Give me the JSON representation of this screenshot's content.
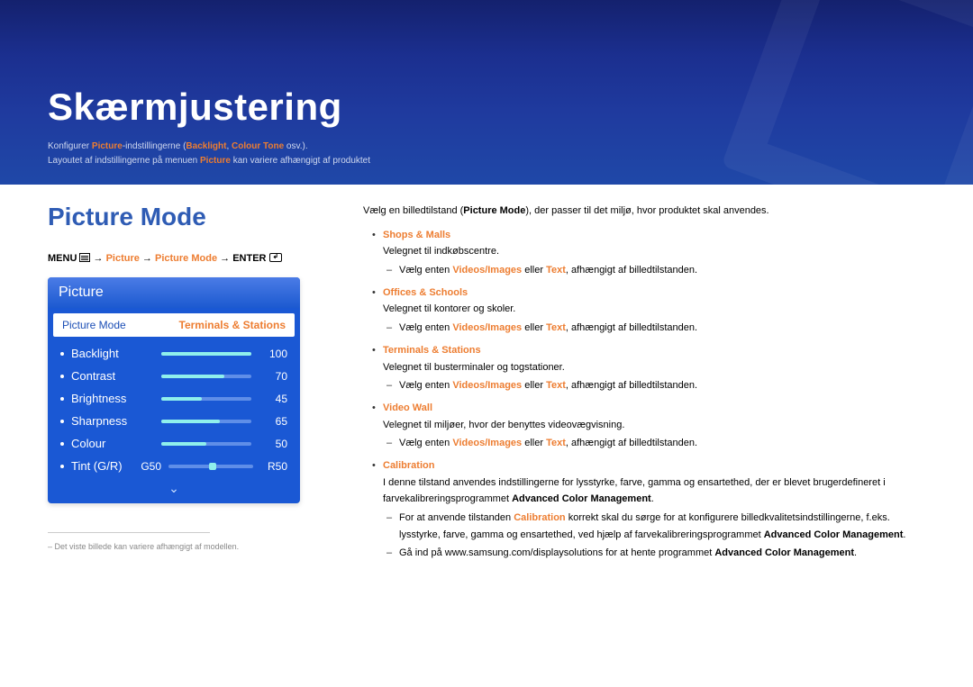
{
  "banner": {
    "title": "Skærmjustering",
    "desc1_a": "Konfigurer ",
    "desc1_b": "Picture",
    "desc1_c": "-indstillingerne (",
    "desc1_d": "Backlight",
    "desc1_e": ", ",
    "desc1_f": "Colour Tone",
    "desc1_g": " osv.).",
    "desc2_a": "Layoutet af indstillingerne på menuen ",
    "desc2_b": "Picture",
    "desc2_c": " kan variere afhængigt af produktet"
  },
  "section_title": "Picture Mode",
  "path": {
    "menu": "MENU ",
    "arrow": " → ",
    "step1": "Picture",
    "step2": "Picture Mode",
    "enter": "ENTER"
  },
  "osd": {
    "header": "Picture",
    "row_label": "Picture Mode",
    "row_value": "Terminals & Stations",
    "items": [
      {
        "label": "Backlight",
        "value": "100",
        "pct": 100
      },
      {
        "label": "Contrast",
        "value": "70",
        "pct": 70
      },
      {
        "label": "Brightness",
        "value": "45",
        "pct": 45
      },
      {
        "label": "Sharpness",
        "value": "65",
        "pct": 65
      },
      {
        "label": "Colour",
        "value": "50",
        "pct": 50
      }
    ],
    "tint_label": "Tint (G/R)",
    "tint_g": "G50",
    "tint_r": "R50"
  },
  "note": "Det viste billede kan variere afhængigt af modellen.",
  "right": {
    "intro_a": "Vælg en billedtilstand (",
    "intro_b": "Picture Mode",
    "intro_c": "), der passer til det miljø, hvor produktet skal anvendes.",
    "modes": [
      {
        "name": "Shops & Malls",
        "desc": "Velegnet til indkøbscentre.",
        "sub_a": "Vælg enten ",
        "sub_b": "Videos/Images",
        "sub_c": " eller ",
        "sub_d": "Text",
        "sub_e": ", afhængigt af billedtilstanden."
      },
      {
        "name": "Offices & Schools",
        "desc": "Velegnet til kontorer og skoler.",
        "sub_a": "Vælg enten ",
        "sub_b": "Videos/Images",
        "sub_c": " eller ",
        "sub_d": "Text",
        "sub_e": ", afhængigt af billedtilstanden."
      },
      {
        "name": "Terminals & Stations",
        "desc": "Velegnet til busterminaler og togstationer.",
        "sub_a": "Vælg enten ",
        "sub_b": "Videos/Images",
        "sub_c": " eller ",
        "sub_d": "Text",
        "sub_e": ", afhængigt af billedtilstanden."
      },
      {
        "name": "Video Wall",
        "desc": "Velegnet til miljøer, hvor der benyttes videovægvisning.",
        "sub_a": "Vælg enten ",
        "sub_b": "Videos/Images",
        "sub_c": " eller ",
        "sub_d": "Text",
        "sub_e": ", afhængigt af billedtilstanden."
      }
    ],
    "calib": {
      "name": "Calibration",
      "desc_a": "I denne tilstand anvendes indstillingerne for lysstyrke, farve, gamma og ensartethed, der er blevet brugerdefineret i farvekalibreringsprogrammet ",
      "desc_b": "Advanced Color Management",
      "desc_c": ".",
      "sub1_a": "For at anvende tilstanden ",
      "sub1_b": "Calibration",
      "sub1_c": " korrekt skal du sørge for at konfigurere billedkvalitetsindstillingerne, f.eks. lysstyrke, farve, gamma og ensartethed, ved hjælp af farvekalibreringsprogrammet ",
      "sub1_d": "Advanced Color Management",
      "sub1_e": ".",
      "sub2_a": "Gå ind på www.samsung.com/displaysolutions for at hente programmet ",
      "sub2_b": "Advanced Color Management",
      "sub2_c": "."
    }
  }
}
